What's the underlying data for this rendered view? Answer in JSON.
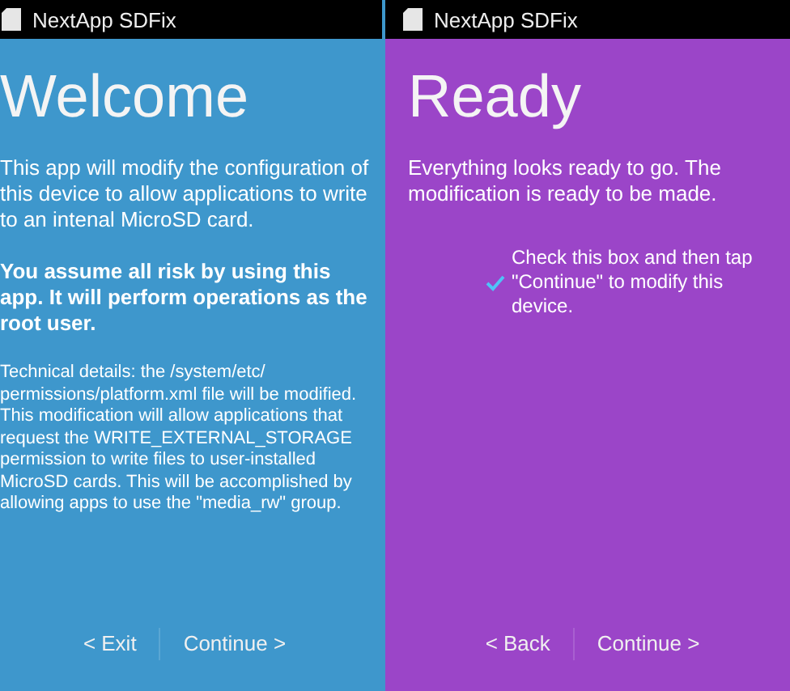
{
  "screens": [
    {
      "app_title": "NextApp SDFix",
      "color": "#3e97cc",
      "heading": "Welcome",
      "paragraphs": [
        {
          "kind": "normal",
          "text": "This app will modify the configuration of this device to allow applications to write to an intenal MicroSD card."
        },
        {
          "kind": "bold",
          "text": "You assume all risk by using this app. It will perform operations as the root user."
        },
        {
          "kind": "small",
          "text": "Technical details: the /system/etc/ permissions/platform.xml file will be modified. This modification will allow applications that request the WRITE_EXTERNAL_STORAGE permission to write files to user-installed MicroSD cards. This will be accomplished by allowing apps to use the \"media_rw\" group."
        }
      ],
      "buttons": [
        "< Exit",
        "Continue >"
      ]
    },
    {
      "app_title": "NextApp SDFix",
      "color": "#9b45c8",
      "heading": "Ready",
      "paragraphs": [
        {
          "kind": "normal",
          "text": "Everything looks ready to go. The modification is ready to be made."
        }
      ],
      "checkbox": {
        "label": "Check this box and then tap \"Continue\" to modify this device.",
        "checked": true
      },
      "buttons": [
        "< Back",
        "Continue >"
      ]
    }
  ]
}
